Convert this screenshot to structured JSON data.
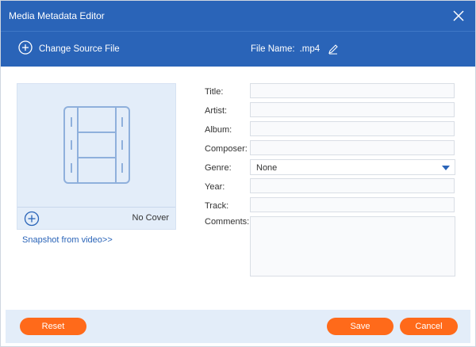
{
  "window": {
    "title": "Media Metadata Editor"
  },
  "toolbar": {
    "change_source_label": "Change Source File",
    "file_name_label": "File Name:",
    "file_name_value": ".mp4"
  },
  "cover": {
    "no_cover_label": "No Cover",
    "snapshot_link": "Snapshot from video>>"
  },
  "form": {
    "title_label": "Title:",
    "artist_label": "Artist:",
    "album_label": "Album:",
    "composer_label": "Composer:",
    "genre_label": "Genre:",
    "genre_value": "None",
    "year_label": "Year:",
    "track_label": "Track:",
    "comments_label": "Comments:"
  },
  "footer": {
    "reset_label": "Reset",
    "save_label": "Save",
    "cancel_label": "Cancel"
  },
  "colors": {
    "header": "#2a64b8",
    "accent_button": "#ff6a1a",
    "panel": "#e3edf9"
  },
  "icons": {
    "close": "close-icon",
    "add_source": "plus-circle-icon",
    "edit": "pencil-icon",
    "film": "film-icon",
    "add_cover": "plus-circle-icon",
    "dropdown": "caret-down-icon"
  }
}
